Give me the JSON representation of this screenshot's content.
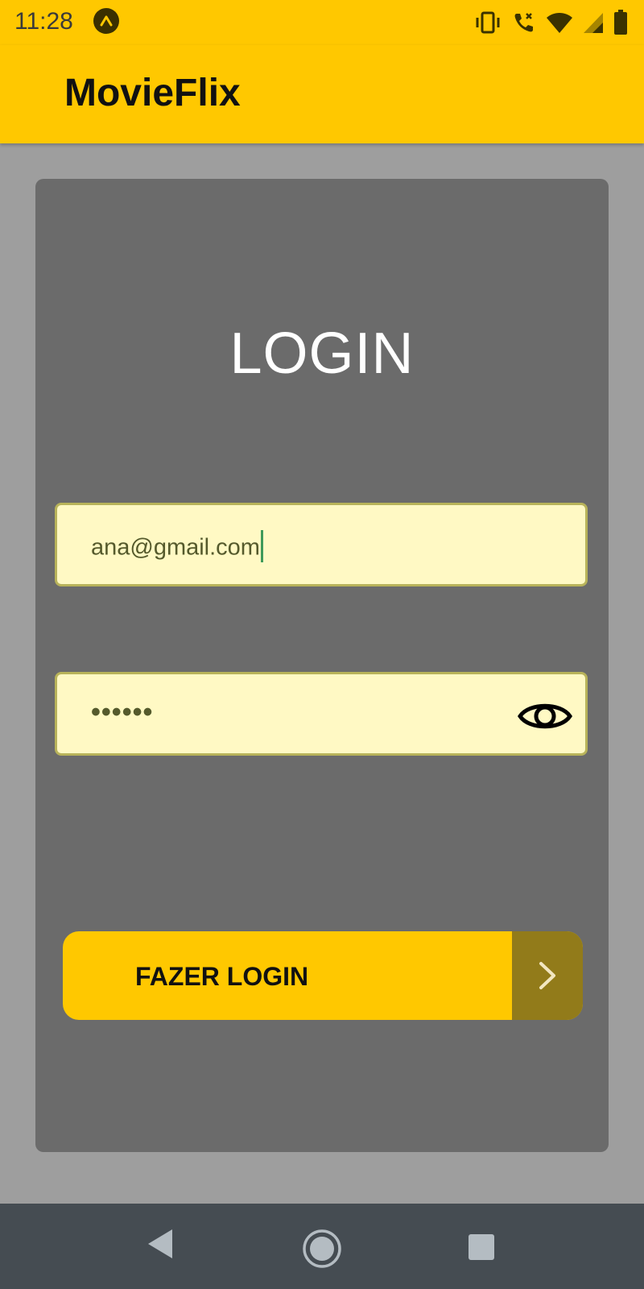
{
  "status_bar": {
    "time": "11:28",
    "icons": [
      "expo-icon",
      "vibrate-icon",
      "wifi-calling-icon",
      "wifi-icon",
      "cellular-icon",
      "battery-icon"
    ]
  },
  "app_bar": {
    "title": "MovieFlix"
  },
  "login": {
    "title": "LOGIN",
    "email_value": "ana@gmail.com",
    "password_value": "••••••",
    "submit_label": "FAZER LOGIN"
  },
  "nav_bar": {
    "icons": [
      "back-icon",
      "home-icon",
      "recents-icon"
    ]
  },
  "colors": {
    "accent": "#ffc800",
    "card": "#6b6b6b",
    "background": "#9e9e9e",
    "input_bg": "#fff9c4",
    "button_arrow_bg": "#927b1a"
  }
}
